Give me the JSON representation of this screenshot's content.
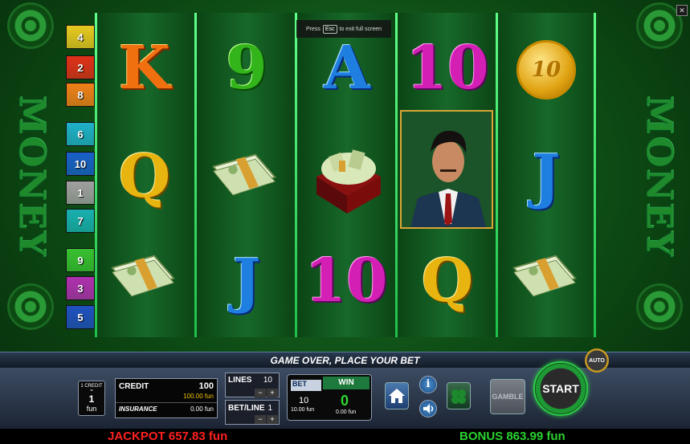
{
  "side_text": "MONEY",
  "line_numbers": [
    {
      "label": "4",
      "color": "#e8c820"
    },
    {
      "label": "2",
      "color": "#e03018"
    },
    {
      "label": "8",
      "color": "#f08018"
    },
    {
      "label": "6",
      "color": "#1fb0c8"
    },
    {
      "label": "10",
      "color": "#1860c8"
    },
    {
      "label": "1",
      "color": "#a0a0a0"
    },
    {
      "label": "7",
      "color": "#18b0b0"
    },
    {
      "label": "9",
      "color": "#38c030"
    },
    {
      "label": "3",
      "color": "#b030b0"
    },
    {
      "label": "5",
      "color": "#2050c0"
    }
  ],
  "reels": {
    "row1": [
      "K",
      "9",
      "A",
      "10",
      "10"
    ],
    "row2": [
      "Q",
      "cash-bundle",
      "cash-box",
      "gangster",
      "J"
    ],
    "row3": [
      "cash-bundle",
      "J",
      "10",
      "Q",
      "cash-bundle"
    ]
  },
  "esc_hint": {
    "press": "Press",
    "key": "Esc",
    "rest": "to exit full screen"
  },
  "status_message": "GAME OVER, PLACE YOUR BET",
  "denomination": {
    "top": "1 CREDIT =",
    "value": "1",
    "unit": "fun"
  },
  "credit": {
    "label": "CREDIT",
    "value": "100",
    "fun": "100.00 fun",
    "insurance_label": "INSURANCE",
    "insurance_value": "0.00 fun"
  },
  "lines": {
    "label": "LINES",
    "value": "10"
  },
  "bet_line": {
    "label": "BET/LINE",
    "value": "1"
  },
  "bet": {
    "label": "BET",
    "value": "10",
    "fun": "10.00 fun"
  },
  "win": {
    "label": "WIN",
    "value": "0",
    "fun": "0.00 fun"
  },
  "gamble_label": "GAMBLE",
  "start_label": "START",
  "auto_label": "AUTO",
  "stepper": {
    "minus": "−",
    "plus": "+"
  },
  "jackpot": {
    "label": "JACKPOT",
    "value": "657.83 fun"
  },
  "bonus": {
    "label": "BONUS",
    "value": "863.99 fun"
  },
  "info_glyph": "i",
  "colors": {
    "jackpot": "#ff2020",
    "bonus": "#29d32f",
    "win": "#2ed62e",
    "reel_sep": "#48ff74"
  }
}
